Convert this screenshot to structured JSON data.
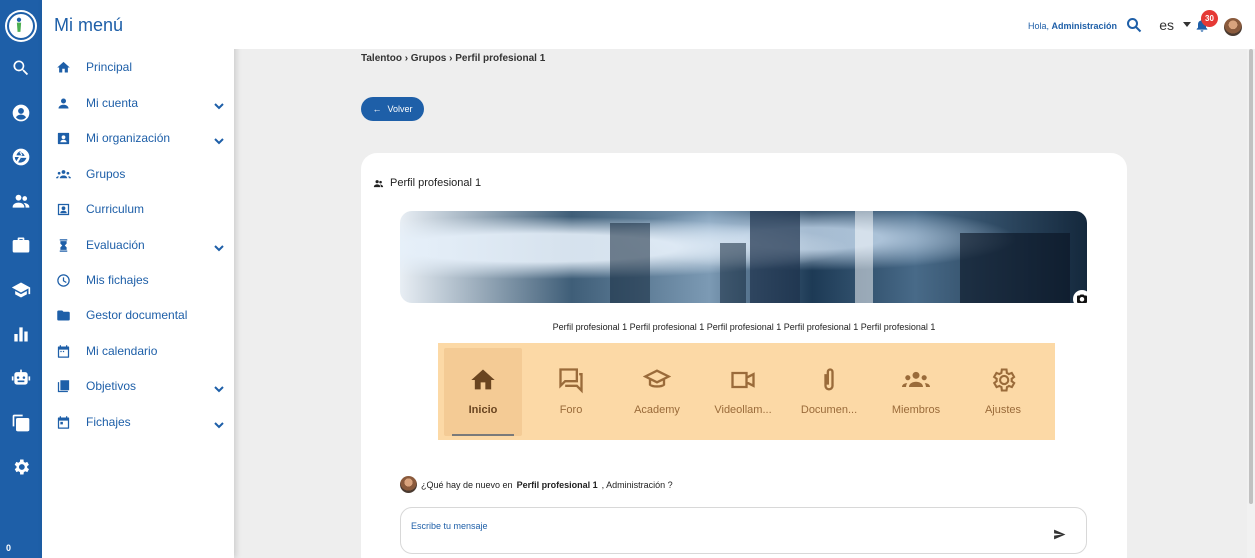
{
  "rail": {
    "icons": [
      "logo-icon",
      "search-icon",
      "account-circle-icon",
      "camera-aperture-icon",
      "people-icon",
      "briefcase-icon",
      "graduation-cap-icon",
      "bar-chart-icon",
      "robot-icon",
      "copy-icon",
      "settings-icon"
    ],
    "bottom_count": "0"
  },
  "menu": {
    "title": "Mi menú",
    "items": [
      {
        "label": "Principal",
        "icon": "home-icon",
        "chevron": false
      },
      {
        "label": "Mi cuenta",
        "icon": "person-icon",
        "chevron": true
      },
      {
        "label": "Mi organización",
        "icon": "badge-icon",
        "chevron": true
      },
      {
        "label": "Grupos",
        "icon": "groups-icon",
        "chevron": false
      },
      {
        "label": "Curriculum",
        "icon": "contact-card-icon",
        "chevron": false
      },
      {
        "label": "Evaluación",
        "icon": "hourglass-icon",
        "chevron": true
      },
      {
        "label": "Mis fichajes",
        "icon": "clock-icon",
        "chevron": false
      },
      {
        "label": "Gestor documental",
        "icon": "folder-icon",
        "chevron": false
      },
      {
        "label": "Mi calendario",
        "icon": "calendar-icon",
        "chevron": false
      },
      {
        "label": "Objetivos",
        "icon": "checklist-icon",
        "chevron": true
      },
      {
        "label": "Fichajes",
        "icon": "event-icon",
        "chevron": true
      }
    ]
  },
  "topbar": {
    "greeting_prefix": "Hola,",
    "greeting_name": "Administración",
    "language": "es",
    "notifications_count": "30"
  },
  "breadcrumb": "Talentoo › Grupos › Perfil profesional 1",
  "back_button": "Volver",
  "group": {
    "title": "Perfil profesional 1",
    "names_line": "Perfil profesional 1 Perfil profesional 1 Perfil profesional 1 Perfil profesional 1 Perfil profesional 1"
  },
  "tabs": [
    {
      "label": "Inicio",
      "icon": "home-icon",
      "active": true
    },
    {
      "label": "Foro",
      "icon": "forum-icon",
      "active": false
    },
    {
      "label": "Academy",
      "icon": "school-icon",
      "active": false
    },
    {
      "label": "Videollam...",
      "icon": "videocam-icon",
      "active": false
    },
    {
      "label": "Documen...",
      "icon": "attachment-icon",
      "active": false
    },
    {
      "label": "Miembros",
      "icon": "groups-icon",
      "active": false
    },
    {
      "label": "Ajustes",
      "icon": "settings-icon",
      "active": false
    }
  ],
  "post": {
    "prefix": "¿Qué hay de nuevo en",
    "group": "Perfil profesional 1",
    "suffix": ", Administración ?",
    "placeholder": "Escribe tu mensaje"
  },
  "colors": {
    "primary": "#1e5fa8",
    "tabbar_bg": "#fcd9a6",
    "tab_icon": "#9a6b3a",
    "tab_active": "#6a4520"
  }
}
